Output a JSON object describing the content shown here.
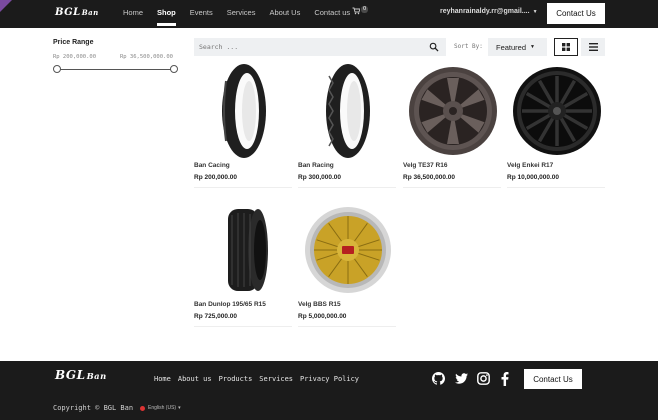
{
  "header": {
    "brand": "BGL",
    "brand_sub": "Ban",
    "nav": [
      "Home",
      "Shop",
      "Events",
      "Services",
      "About Us",
      "Contact us"
    ],
    "active_nav": "Shop",
    "cart_count": "0",
    "user": "reyhanrainaldy.rr@gmail....",
    "contact_label": "Contact Us"
  },
  "sidebar": {
    "price_title": "Price Range",
    "min_label": "Rp 200,000.00",
    "max_label": "Rp 36,500,000.00"
  },
  "toolbar": {
    "search_placeholder": "Search ...",
    "sort_label": "Sort By:",
    "sort_value": "Featured"
  },
  "products": [
    {
      "name": "Ban Cacing",
      "price": "Rp 200,000.00",
      "icon": "tire-slick-icon"
    },
    {
      "name": "Ban Racing",
      "price": "Rp 300,000.00",
      "icon": "tire-racing-icon"
    },
    {
      "name": "Velg TE37 R16",
      "price": "Rp 36,500,000.00",
      "icon": "wheel-te37-icon"
    },
    {
      "name": "Velg Enkei R17",
      "price": "Rp 10,000,000.00",
      "icon": "wheel-enkei-icon"
    },
    {
      "name": "Ban Dunlop 195/65 R15",
      "price": "Rp 725,000.00",
      "icon": "tire-dunlop-icon"
    },
    {
      "name": "Velg BBS R15",
      "price": "Rp 5,000,000.00",
      "icon": "wheel-bbs-icon"
    }
  ],
  "footer": {
    "brand": "BGL",
    "brand_sub": "Ban",
    "nav": [
      "Home",
      "About us",
      "Products",
      "Services",
      "Privacy Policy"
    ],
    "social": [
      "github-icon",
      "twitter-icon",
      "instagram-icon",
      "facebook-icon"
    ],
    "contact_label": "Contact Us",
    "copyright": "Copyright © BGL Ban",
    "language": "English (US)"
  },
  "colors": {
    "dark_bar": "#1b1b1b",
    "accent_corner": "#7a4aa0",
    "bbs_gold": "#c9a227"
  }
}
